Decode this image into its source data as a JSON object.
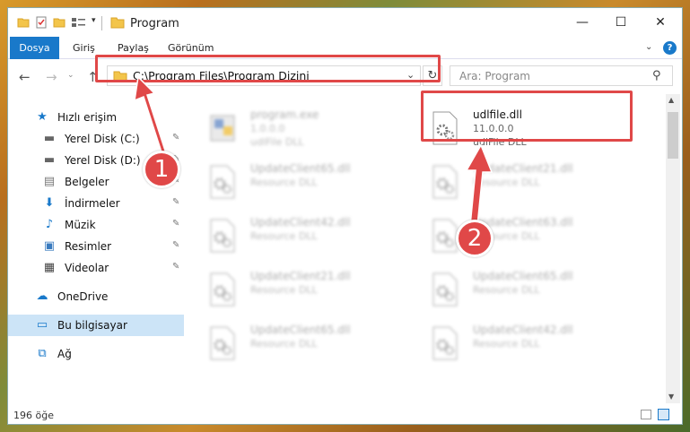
{
  "window": {
    "title": "Program",
    "min_glyph": "—",
    "max_glyph": "☐",
    "close_glyph": "✕"
  },
  "ribbon": {
    "tabs": [
      "Dosya",
      "Giriş",
      "Paylaş",
      "Görünüm"
    ],
    "help": "?",
    "chevron": "⌄"
  },
  "nav": {
    "back": "←",
    "forward": "→",
    "up": "↑",
    "recent": "⌄",
    "address": "C:\\Program Files\\Program Dizini",
    "address_dd": "⌄",
    "refresh": "↻",
    "search_placeholder": "Ara: Program",
    "search_glyph": "⚲"
  },
  "sidebar": {
    "items": [
      {
        "label": "Hızlı erişim",
        "icon": "star-icon",
        "glyph": "★",
        "pinned": false
      },
      {
        "label": "Yerel Disk (C:)",
        "icon": "drive-icon",
        "glyph": "▬",
        "pinned": true
      },
      {
        "label": "Yerel Disk (D:)",
        "icon": "drive-icon",
        "glyph": "▬",
        "pinned": true
      },
      {
        "label": "Belgeler",
        "icon": "documents-icon",
        "glyph": "▤",
        "pinned": true
      },
      {
        "label": "İndirmeler",
        "icon": "download-icon",
        "glyph": "⬇",
        "pinned": true
      },
      {
        "label": "Müzik",
        "icon": "music-icon",
        "glyph": "♪",
        "pinned": true
      },
      {
        "label": "Resimler",
        "icon": "pictures-icon",
        "glyph": "▣",
        "pinned": true
      },
      {
        "label": "Videolar",
        "icon": "videos-icon",
        "glyph": "▦",
        "pinned": true
      },
      {
        "label": "OneDrive",
        "icon": "cloud-icon",
        "glyph": "☁",
        "pinned": false
      },
      {
        "label": "Bu bilgisayar",
        "icon": "computer-icon",
        "glyph": "▭",
        "pinned": false
      },
      {
        "label": "Ağ",
        "icon": "network-icon",
        "glyph": "⧉",
        "pinned": false
      }
    ],
    "pin_glyph": "✎"
  },
  "files": [
    {
      "name": "program.exe",
      "line2": "1.0.0.0",
      "line3": "udlFile DLL",
      "icon": "exe-icon"
    },
    {
      "name": "udlfile.dll",
      "line2": "11.0.0.0",
      "line3": "udlFile DLL",
      "icon": "dll-gear-icon"
    },
    {
      "name": "UpdateClient65.dll",
      "line2": "Resource DLL",
      "line3": "",
      "icon": "dll-gear-icon"
    },
    {
      "name": "UpdateClient21.dll",
      "line2": "Resource DLL",
      "line3": "",
      "icon": "dll-gear-icon"
    },
    {
      "name": "UpdateClient42.dll",
      "line2": "Resource DLL",
      "line3": "",
      "icon": "dll-gear-icon"
    },
    {
      "name": "UpdateClient63.dll",
      "line2": "Resource DLL",
      "line3": "",
      "icon": "dll-gear-icon"
    },
    {
      "name": "UpdateClient21.dll",
      "line2": "Resource DLL",
      "line3": "",
      "icon": "dll-gear-icon"
    },
    {
      "name": "UpdateClient65.dll",
      "line2": "Resource DLL",
      "line3": "",
      "icon": "dll-gear-icon"
    },
    {
      "name": "UpdateClient65.dll",
      "line2": "Resource DLL",
      "line3": "",
      "icon": "dll-gear-icon"
    },
    {
      "name": "UpdateClient42.dll",
      "line2": "Resource DLL",
      "line3": "",
      "icon": "dll-gear-icon"
    }
  ],
  "status": {
    "count": "196 öğe"
  },
  "annotations": {
    "step1": "1",
    "step2": "2",
    "color": "#e04848"
  },
  "scroll": {
    "up": "▲",
    "down": "▼"
  }
}
